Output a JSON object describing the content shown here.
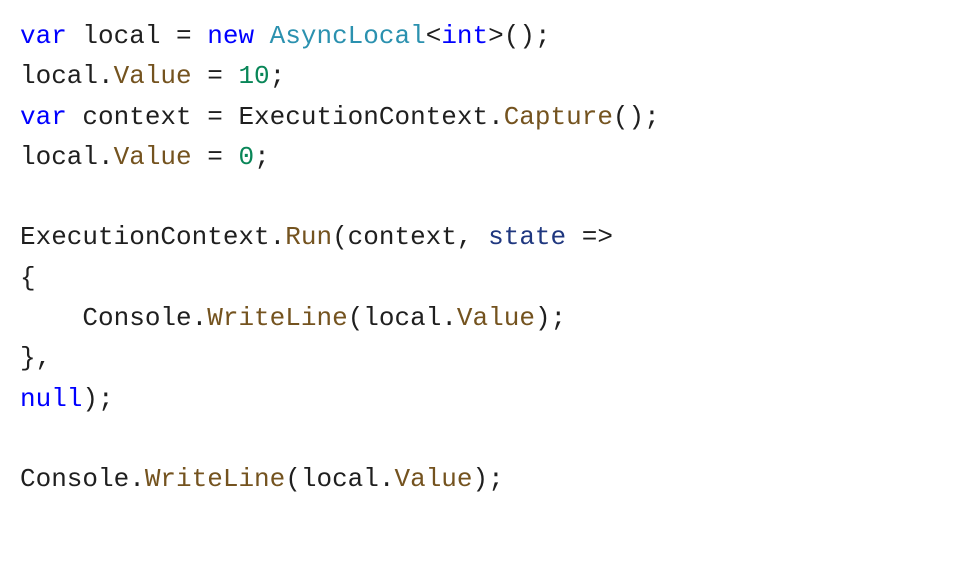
{
  "code": {
    "l1": {
      "kw_var1": "var",
      "sp": " ",
      "local": "local",
      "eq": " = ",
      "kw_new": "new",
      "sp2": " ",
      "type": "AsyncLocal",
      "lt": "<",
      "int": "int",
      "gt": ">",
      "parens": "();"
    },
    "l2": {
      "local": "local",
      "dot": ".",
      "value": "Value",
      "eq": " = ",
      "num": "10",
      "semi": ";"
    },
    "l3": {
      "kw_var": "var",
      "sp": " ",
      "ctx": "context",
      "eq": " = ",
      "cls": "ExecutionContext",
      "dot": ".",
      "cap": "Capture",
      "parens": "();"
    },
    "l4": {
      "local": "local",
      "dot": ".",
      "value": "Value",
      "eq": " = ",
      "num": "0",
      "semi": ";"
    },
    "l5": "",
    "l6": {
      "cls": "ExecutionContext",
      "dot": ".",
      "run": "Run",
      "open": "(",
      "ctx": "context",
      "comma": ", ",
      "state": "state",
      "arrow": " =>"
    },
    "l7": "{",
    "l8": {
      "indent": "    ",
      "cls": "Console",
      "dot": ".",
      "wl": "WriteLine",
      "open": "(",
      "local": "local",
      "dot2": ".",
      "value": "Value",
      "close": ");"
    },
    "l9": "},",
    "l10": {
      "null": "null",
      "close": ");"
    },
    "l11": "",
    "l12": {
      "cls": "Console",
      "dot": ".",
      "wl": "WriteLine",
      "open": "(",
      "local": "local",
      "dot2": ".",
      "value": "Value",
      "close": ");"
    }
  }
}
